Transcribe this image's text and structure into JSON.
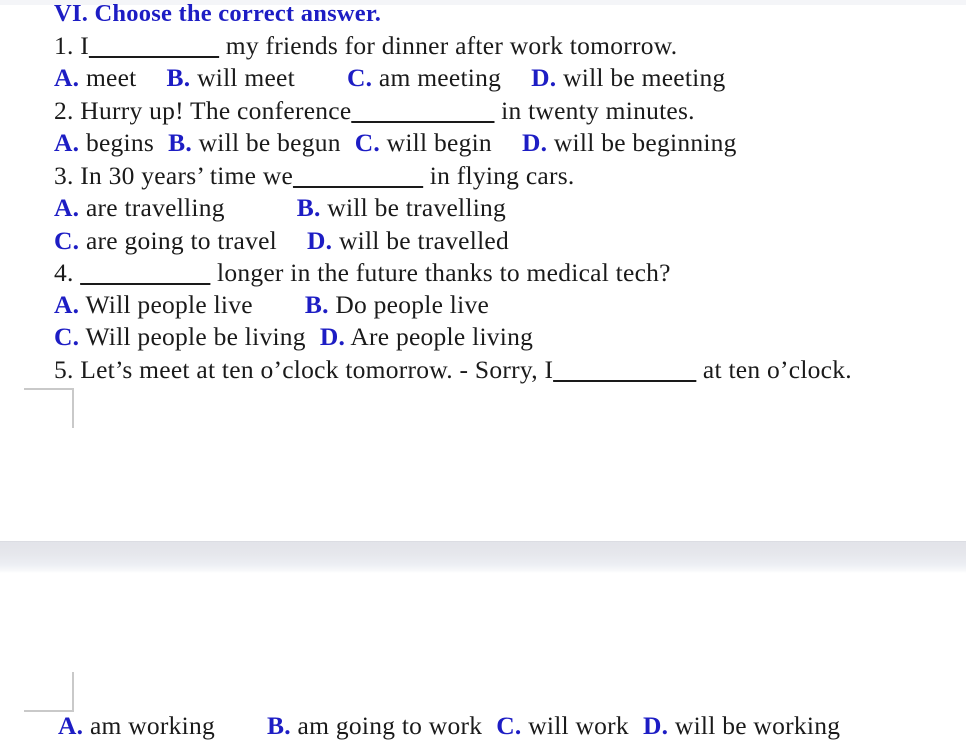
{
  "document": {
    "app_context": "word-processor-document-view",
    "heading": "VI. Choose the correct answer.",
    "colors": {
      "heading_blue": "#1d1dc4",
      "option_letter_blue": "#1d1dc4",
      "body_text": "#1a1a1a",
      "page_gap_gray": "#e6e7ec",
      "margin_mark_gray": "#c9c9c9"
    },
    "questions": [
      {
        "number": "1.",
        "stem_before": " I",
        "blank": "__________",
        "stem_after": " my friends for dinner after work tomorrow.",
        "option_rows": [
          [
            {
              "letter": "A.",
              "text": " meet"
            },
            {
              "letter": "B.",
              "text": " will meet"
            },
            {
              "letter": "C.",
              "text": " am meeting"
            },
            {
              "letter": "D.",
              "text": " will be meeting"
            }
          ]
        ]
      },
      {
        "number": "2.",
        "stem_before": " Hurry up! The conference",
        "blank": "___________",
        "stem_after": " in twenty minutes.",
        "option_rows": [
          [
            {
              "letter": "A.",
              "text": " begins"
            },
            {
              "letter": "B.",
              "text": " will be begun"
            },
            {
              "letter": "C.",
              "text": " will begin"
            },
            {
              "letter": "D.",
              "text": " will be beginning"
            }
          ]
        ]
      },
      {
        "number": "3.",
        "stem_before": " In 30 years’ time we",
        "blank": "__________",
        "stem_after": " in flying cars.",
        "option_rows": [
          [
            {
              "letter": "A.",
              "text": " are travelling"
            },
            {
              "letter": "B.",
              "text": " will be travelling"
            }
          ],
          [
            {
              "letter": "C.",
              "text": " are going to travel"
            },
            {
              "letter": "D.",
              "text": " will be travelled"
            }
          ]
        ]
      },
      {
        "number": "4.",
        "stem_before": " ",
        "blank": "__________",
        "stem_after": " longer in the future thanks to medical tech?",
        "option_rows": [
          [
            {
              "letter": "A.",
              "text": " Will people live"
            },
            {
              "letter": "B.",
              "text": " Do people live"
            }
          ],
          [
            {
              "letter": "C.",
              "text": " Will people be living"
            },
            {
              "letter": "D.",
              "text": " Are people living"
            }
          ]
        ]
      },
      {
        "number": "5.",
        "stem_before": " Let’s meet at ten o’clock tomorrow. - Sorry, I",
        "blank": "___________",
        "stem_after": " at ten o’clock.",
        "option_rows": [
          [
            {
              "letter": "A.",
              "text": " am working"
            },
            {
              "letter": "B.",
              "text": " am going to work"
            },
            {
              "letter": "C.",
              "text": " will work"
            },
            {
              "letter": "D.",
              "text": " will be working"
            }
          ]
        ]
      }
    ],
    "lines": {
      "l_heading": "VI. Choose the correct answer.",
      "l1_num": "1.",
      "l1_a": " I",
      "l1_blank": "__________",
      "l1_b": " my friends for dinner after work tomorrow.",
      "l1o_a": "A.",
      "l1o_at": " meet",
      "l1o_b": "B.",
      "l1o_bt": " will meet",
      "l1o_c": "C.",
      "l1o_ct": " am meeting",
      "l1o_d": "D.",
      "l1o_dt": " will be meeting",
      "l2_num": "2.",
      "l2_a": " Hurry up! The conference",
      "l2_blank": "___________",
      "l2_b": " in twenty minutes.",
      "l2o_a": "A.",
      "l2o_at": " begins",
      "l2o_b": "B.",
      "l2o_bt": " will be begun",
      "l2o_c": "C.",
      "l2o_ct": " will begin",
      "l2o_d": "D.",
      "l2o_dt": " will be beginning",
      "l3_num": "3.",
      "l3_a": " In 30 years’ time we",
      "l3_blank": "__________",
      "l3_b": " in flying cars.",
      "l3o_a": "A.",
      "l3o_at": " are travelling",
      "l3o_b": "B.",
      "l3o_bt": " will be travelling",
      "l3o_c": "C.",
      "l3o_ct": " are going to travel",
      "l3o_d": "D.",
      "l3o_dt": " will be travelled",
      "l4_num": "4.",
      "l4_a": " ",
      "l4_blank": "__________",
      "l4_b": " longer in the future thanks to medical tech?",
      "l4o_a": "A.",
      "l4o_at": " Will people live",
      "l4o_b": "B.",
      "l4o_bt": " Do people live",
      "l4o_c": "C.",
      "l4o_ct": " Will people be living",
      "l4o_d": "D.",
      "l4o_dt": " Are people living",
      "l5_num": "5.",
      "l5_a": " Let’s meet at ten o’clock tomorrow. - Sorry, I",
      "l5_blank": "___________",
      "l5_b": " at ten o’clock.",
      "l5o_a": "A.",
      "l5o_at": " am working",
      "l5o_b": "B.",
      "l5o_bt": " am going to work",
      "l5o_c": "C.",
      "l5o_ct": " will work",
      "l5o_d": "D.",
      "l5o_dt": " will be working"
    }
  }
}
